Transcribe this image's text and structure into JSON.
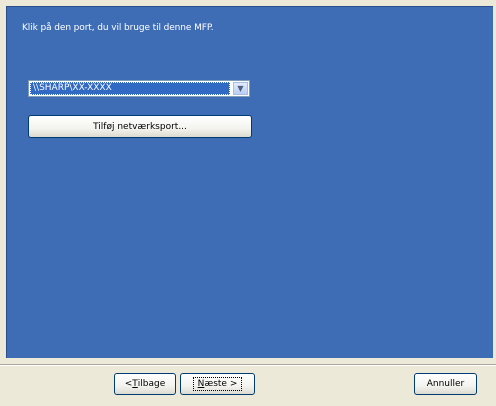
{
  "instruction_text": "Klik på den port, du vil bruge til denne MFP.",
  "port_select": {
    "selected_value": "\\\\SHARP\\XX-XXXX",
    "arrow_icon": "chevron-down-icon"
  },
  "add_port_button_label": "Tilføj netværksport...",
  "footer": {
    "back_prefix": "< ",
    "back_mnemonic": "T",
    "back_rest": "ilbage",
    "next_mnemonic": "N",
    "next_rest": "æste >",
    "cancel_label": "Annuller"
  },
  "colors": {
    "panel_background": "#3e6db6",
    "selection_highlight": "#316ac5",
    "dialog_background": "#ece9d8"
  }
}
